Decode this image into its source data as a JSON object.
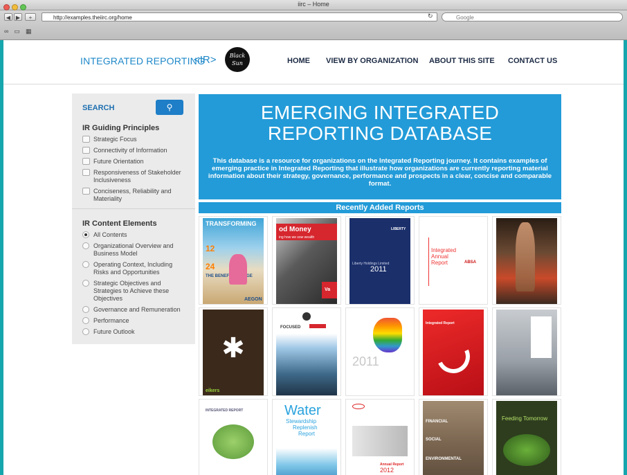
{
  "browser": {
    "window_title": "iirc – Home",
    "url": "http://examples.theiirc.org/home",
    "search_placeholder": "Google"
  },
  "site": {
    "logo_text": "INTEGRATED REPORTING",
    "logo_badge": "<IR>",
    "seal_text": "Black Sun",
    "nav": [
      "HOME",
      "VIEW BY ORGANIZATION",
      "ABOUT THIS SITE",
      "CONTACT US"
    ]
  },
  "sidebar": {
    "search_label": "SEARCH",
    "principles_heading": "IR Guiding Principles",
    "principles": [
      "Strategic Focus",
      "Connectivity of Information",
      "Future Orientation",
      "Responsiveness of Stakeholder Inclusiveness",
      "Conciseness, Reliability and Materiality"
    ],
    "elements_heading": "IR Content Elements",
    "elements": [
      "All Contents",
      "Organizational Overview and Business Model",
      "Operating Context, Including Risks and Opportunities",
      "Strategic Objectives and Strategies to Achieve these Objectives",
      "Governance and Remuneration",
      "Performance",
      "Future Outlook"
    ],
    "selected_element": "All Contents"
  },
  "hero": {
    "title_line1": "EMERGING INTEGRATED",
    "title_line2": "REPORTING DATABASE",
    "description": "This database is a resource for organizations on the Integrated Reporting journey. It contains examples of emerging practice in Integrated Reporting that illustrate how organizations are currently reporting material information about their strategy, governance, performance and prospects in a clear, concise and comparable format."
  },
  "recent": {
    "heading": "Recently Added Reports",
    "covers": [
      {
        "lines": [
          "TRANSFORMING",
          "12",
          "24",
          "THE BENEFITS OF AGE",
          "AEGON"
        ]
      },
      {
        "lines": [
          "od Money",
          "ing how we sow wealth",
          "Va"
        ]
      },
      {
        "lines": [
          "LIBERTY",
          "Liberty Holdings Limited",
          "2011"
        ]
      },
      {
        "lines": [
          "Integrated Annual Report",
          "ABSA"
        ]
      },
      {
        "lines": []
      },
      {
        "lines": [
          "eikers"
        ]
      },
      {
        "lines": [
          "FOCUSED"
        ]
      },
      {
        "lines": [
          "2011"
        ]
      },
      {
        "lines": [
          "Integrated Report"
        ]
      },
      {
        "lines": []
      },
      {
        "lines": [
          "INTEGRATED REPORT"
        ]
      },
      {
        "lines": [
          "Water",
          "Stewardship",
          "Replenish",
          "Report"
        ]
      },
      {
        "lines": [
          "Annual Report",
          "2012"
        ]
      },
      {
        "lines": [
          "FINANCIAL",
          "SOCIAL",
          "ENVIRONMENTAL"
        ]
      },
      {
        "lines": [
          "Feeding Tomorrow"
        ]
      }
    ]
  },
  "colors": {
    "brand_blue": "#239bd8",
    "desktop_teal": "#16a6ad",
    "nav_text": "#1c2a44"
  }
}
